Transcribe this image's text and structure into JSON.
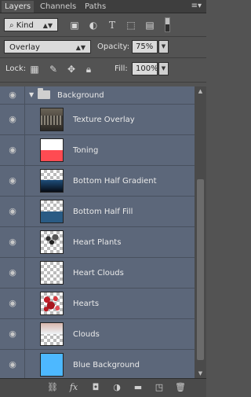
{
  "tabs": [
    "Layers",
    "Channels",
    "Paths"
  ],
  "filter": {
    "kind_label": "Kind"
  },
  "blend": {
    "mode": "Overlay",
    "opacity_label": "Opacity:",
    "opacity_value": "75%"
  },
  "lock": {
    "label": "Lock:",
    "fill_label": "Fill:",
    "fill_value": "100%"
  },
  "group": {
    "name": "Background"
  },
  "layers": [
    {
      "name": "Texture Overlay"
    },
    {
      "name": "Toning"
    },
    {
      "name": "Bottom Half Gradient"
    },
    {
      "name": "Bottom Half Fill"
    },
    {
      "name": "Heart Plants"
    },
    {
      "name": "Heart Clouds"
    },
    {
      "name": "Hearts"
    },
    {
      "name": "Clouds"
    },
    {
      "name": "Blue Background"
    }
  ],
  "colors": {
    "toning": "#ff4b52",
    "bottom_fill": "#2a5b84",
    "blue_background": "#4db8ff",
    "panel_bg": "#535353",
    "layer_bg": "#5c677a"
  }
}
